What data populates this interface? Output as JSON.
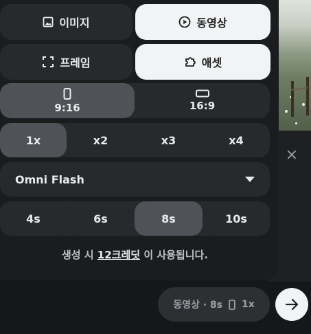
{
  "media_type": {
    "image_label": "이미지",
    "video_label": "동영상",
    "selected": "video"
  },
  "source_mode": {
    "frame_label": "프레임",
    "asset_label": "애셋",
    "selected": "asset"
  },
  "aspect_ratio": {
    "options": [
      "9:16",
      "16:9"
    ],
    "selected": "9:16"
  },
  "output_count": {
    "options": [
      "1x",
      "x2",
      "x3",
      "x4"
    ],
    "selected": "1x"
  },
  "model_select": {
    "value": "Omni Flash"
  },
  "duration": {
    "options": [
      "4s",
      "6s",
      "8s",
      "10s"
    ],
    "selected": "8s"
  },
  "credit_notice": {
    "prefix": "생성 시",
    "amount": "12크레딧",
    "suffix": "이 사용됩니다."
  },
  "summary_chip": {
    "text": "동영상 · 8s",
    "count": "1x"
  },
  "icons": {
    "image": "image-icon",
    "video": "play-circle-icon",
    "frame": "frame-corners-icon",
    "asset": "puzzle-icon",
    "portrait": "portrait-aspect-icon",
    "landscape": "landscape-aspect-icon",
    "close": "close-icon",
    "send": "arrow-right-icon"
  },
  "colors": {
    "panel_bg": "#1b1c1e",
    "segment_bg": "#28292c",
    "selected_light": "#f1f3f4",
    "selected_gray": "#505257"
  }
}
